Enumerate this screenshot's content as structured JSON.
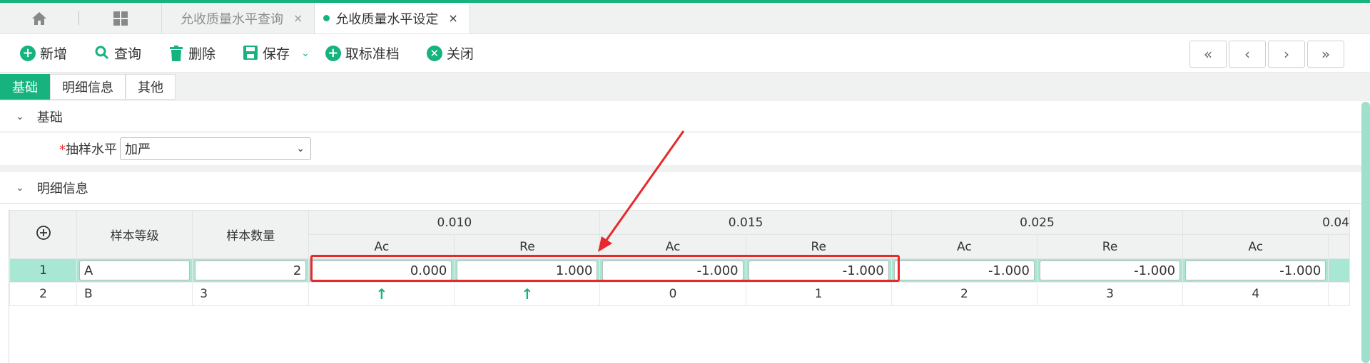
{
  "colors": {
    "accent": "#16b37e",
    "highlight_row": "#a8e7d4",
    "red_annotation": "#e8282b"
  },
  "tabs": [
    {
      "label": "允收质量水平查询",
      "close": "×"
    },
    {
      "label": "允收质量水平设定",
      "close": "×"
    }
  ],
  "toolbar": {
    "new": "新增",
    "query": "查询",
    "delete": "删除",
    "save": "保存",
    "cancel_archive": "取标准档",
    "close": "关闭",
    "nav": [
      "«",
      "‹",
      "›",
      "»"
    ]
  },
  "subtabs": [
    "基础",
    "明细信息",
    "其他"
  ],
  "section_basic": "基础",
  "sampling_level_label": "抽样水平",
  "sampling_level_value": "加严",
  "section_detail": "明细信息",
  "grid": {
    "col_headers": {
      "sample_grade": "样本等级",
      "sample_qty": "样本数量"
    },
    "groups": [
      "0.010",
      "0.015",
      "0.025",
      "0.04"
    ],
    "sub": [
      "Ac",
      "Re",
      "Ac",
      "Re",
      "Ac",
      "Re",
      "Ac"
    ],
    "rows": [
      {
        "no": "1",
        "grade": "A",
        "qty": "2",
        "vals": [
          "0.000",
          "1.000",
          "-1.000",
          "-1.000",
          "-1.000",
          "-1.000",
          "-1.000"
        ]
      },
      {
        "no": "2",
        "grade": "B",
        "qty": "3",
        "vals": [
          "↑",
          "↑",
          "0",
          "1",
          "2",
          "3",
          "4"
        ]
      }
    ]
  }
}
